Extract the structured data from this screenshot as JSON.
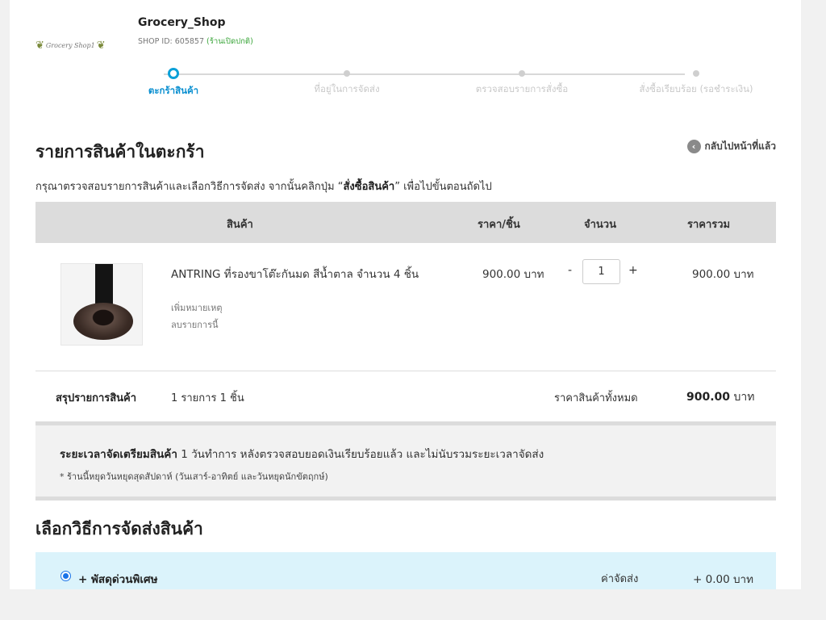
{
  "shop": {
    "logo_text": "Grocery Shop1",
    "name": "Grocery_Shop",
    "id_text": "SHOP ID: 605857",
    "status": "(ร้านเปิดปกติ)"
  },
  "steps": [
    {
      "label": "ตะกร้าสินค้า",
      "active": true
    },
    {
      "label": "ที่อยู่ในการจัดส่ง",
      "active": false
    },
    {
      "label": "ตรวจสอบรายการสั่งซื้อ",
      "active": false
    },
    {
      "label": "สั่งซื้อเรียบร้อย (รอชำระเงิน)",
      "active": false
    }
  ],
  "back_label": "กลับไปหน้าที่แล้ว",
  "cart": {
    "title": "รายการสินค้าในตะกร้า",
    "instructions_before": "กรุณาตรวจสอบรายการสินค้าและเลือกวิธีการจัดส่ง จากนั้นคลิกปุ่ม “",
    "instructions_bold": "สั่งซื้อสินค้า",
    "instructions_after": "” เพื่อไปขั้นตอนถัดไป",
    "headers": {
      "product": "สินค้า",
      "unit_price": "ราคา/ชิ้น",
      "quantity": "จำนวน",
      "total": "ราคารวม"
    },
    "items": [
      {
        "name": "ANTRING ที่รองขาโต๊ะกันมด สีน้ำตาล จำนวน 4 ชิ้น",
        "add_note": "เพิ่มหมายเหตุ",
        "remove": "ลบรายการนี้",
        "unit_price": "900.00 บาท",
        "minus": "-",
        "quantity": "1",
        "plus": "+",
        "total": "900.00 บาท"
      }
    ],
    "summary": {
      "label": "สรุปรายการสินค้า",
      "count_text": "1 รายการ 1 ชิ้น",
      "total_label": "ราคาสินค้าทั้งหมด",
      "total_value": "900.00",
      "currency": "บาท"
    }
  },
  "prep": {
    "label": "ระยะเวลาจัดเตรียมสินค้า",
    "text": " 1 วันทำการ หลังตรวจสอบยอดเงินเรียบร้อยแล้ว และไม่นับรวมระยะเวลาจัดส่ง",
    "note": "* ร้านนี้หยุดวันหยุดสุดสัปดาห์ (วันเสาร์-อาทิตย์ และวันหยุดนักขัตฤกษ์)"
  },
  "shipping": {
    "title": "เลือกวิธีการจัดส่งสินค้า",
    "options": [
      {
        "name": "+ พัสดุด่วนพิเศษ",
        "fee_label": "ค่าจัดส่ง",
        "fee": "+ 0.00 บาท",
        "selected": true
      }
    ]
  },
  "colors": {
    "accent": "#0aa0d8",
    "shipping_bg": "#dbf3fb",
    "header_bg": "#dcdcdc"
  }
}
